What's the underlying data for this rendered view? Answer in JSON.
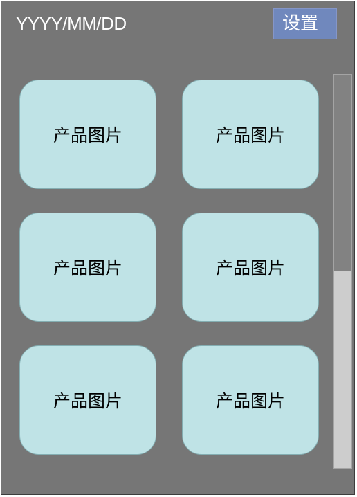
{
  "header": {
    "date_format": "YYYY/MM/DD",
    "settings_label": "设置"
  },
  "products": [
    {
      "label": "产品图片"
    },
    {
      "label": "产品图片"
    },
    {
      "label": "产品图片"
    },
    {
      "label": "产品图片"
    },
    {
      "label": "产品图片"
    },
    {
      "label": "产品图片"
    }
  ],
  "scrollbar": {
    "position_fraction": 1.0,
    "thumb_fraction": 0.5
  },
  "colors": {
    "background": "#767676",
    "card": "#bfe3e6",
    "settings_button": "#7088bd",
    "scroll_track": "#828282",
    "scroll_thumb": "#cdcdcd"
  }
}
